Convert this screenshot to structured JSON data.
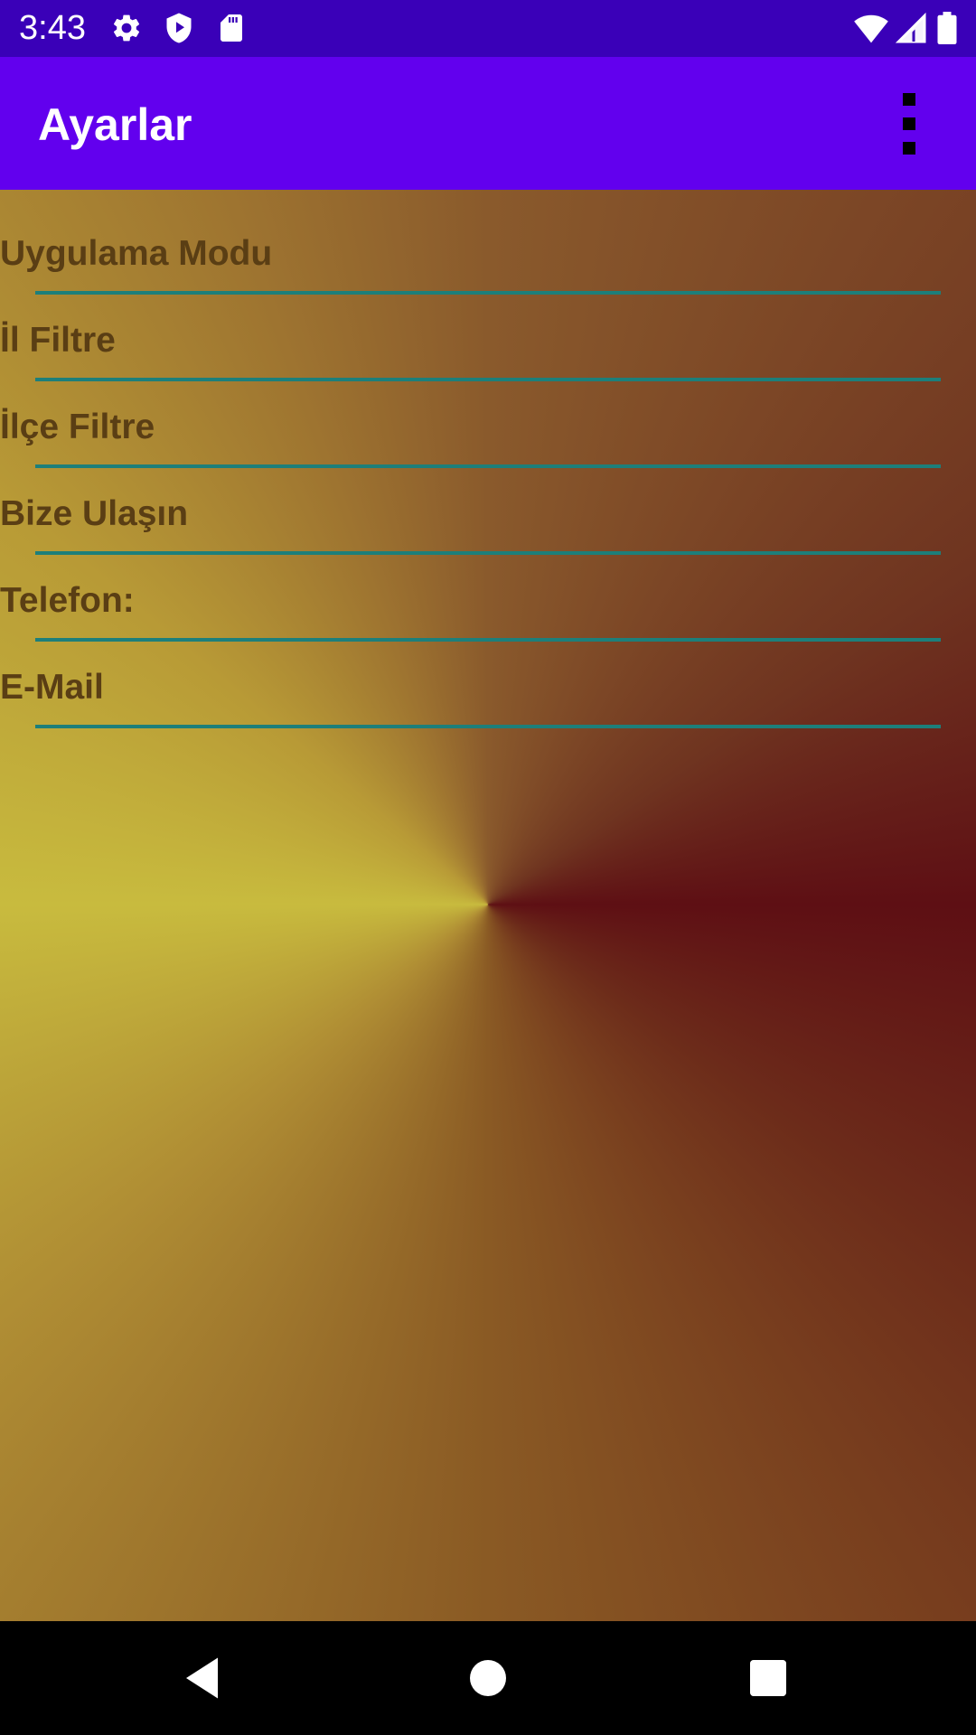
{
  "status_bar": {
    "time": "3:43",
    "left_icons": [
      "gear-icon",
      "shield-play-icon",
      "sd-card-icon"
    ],
    "right_icons": [
      "wifi-icon",
      "cell-signal-icon",
      "battery-icon"
    ],
    "background": "#3a00b8"
  },
  "app_bar": {
    "title": "Ayarlar",
    "overflow_icon": "more-vert-icon",
    "background": "#6200ee"
  },
  "settings": {
    "items": [
      {
        "label": "Uygulama Modu"
      },
      {
        "label": "İl Filtre"
      },
      {
        "label": "İlçe Filtre"
      },
      {
        "label": "Bize Ulaşın"
      },
      {
        "label": "Telefon:"
      },
      {
        "label": "E-Mail"
      }
    ],
    "label_color": "#5a3e14",
    "divider_color": "#1d7f7a"
  },
  "background_gradient": {
    "type": "conic",
    "colors": [
      "#c8bb3e",
      "#8a5a2c",
      "#5e0f14"
    ]
  },
  "nav_bar": {
    "icons": [
      "back-icon",
      "home-icon",
      "recents-icon"
    ]
  }
}
